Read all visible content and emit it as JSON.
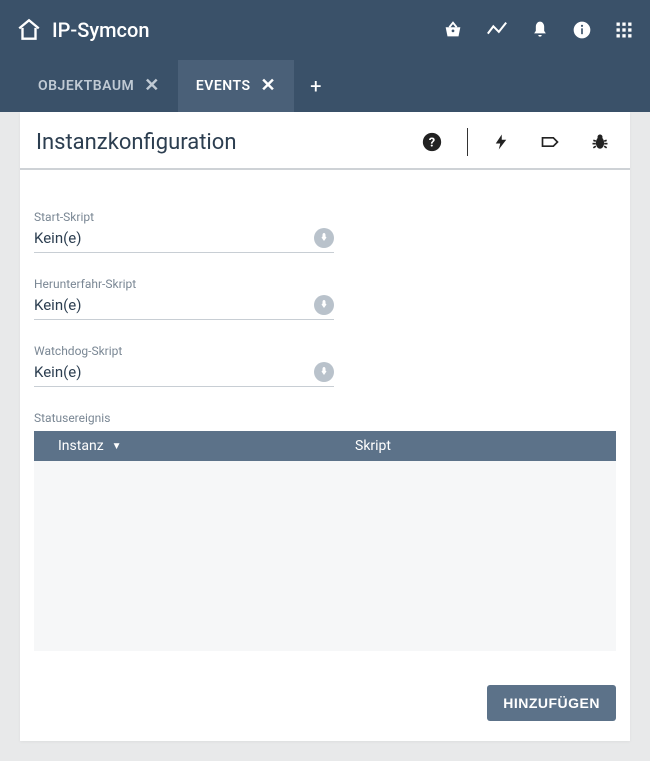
{
  "app": {
    "title": "IP-Symcon"
  },
  "tabs": {
    "items": [
      {
        "label": "OBJEKTBAUM",
        "active": false
      },
      {
        "label": "EVENTS",
        "active": true
      }
    ]
  },
  "panel": {
    "title": "Instanzkonfiguration"
  },
  "form": {
    "start_script": {
      "label": "Start-Skript",
      "value": "Kein(e)"
    },
    "shutdown_script": {
      "label": "Herunterfahr-Skript",
      "value": "Kein(e)"
    },
    "watchdog_script": {
      "label": "Watchdog-Skript",
      "value": "Kein(e)"
    }
  },
  "status_event": {
    "section_label": "Statusereignis",
    "col_instance": "Instanz",
    "col_script": "Skript"
  },
  "buttons": {
    "add": "HINZUFÜGEN"
  }
}
